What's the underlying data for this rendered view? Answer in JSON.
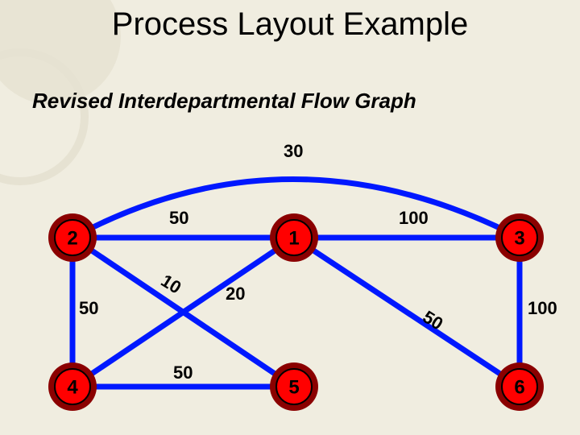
{
  "title": "Process Layout Example",
  "subtitle": "Revised Interdepartmental Flow Graph",
  "nodes": {
    "n2": "2",
    "n1": "1",
    "n3": "3",
    "n4": "4",
    "n5": "5",
    "n6": "6"
  },
  "edges": {
    "e_2_3_arc": "30",
    "e_2_1": "50",
    "e_1_3": "100",
    "e_2_5": "10",
    "e_4_1": "20",
    "e_4_5": "50",
    "e_1_6": "50",
    "e_2_4": "50",
    "e_3_6": "100"
  }
}
